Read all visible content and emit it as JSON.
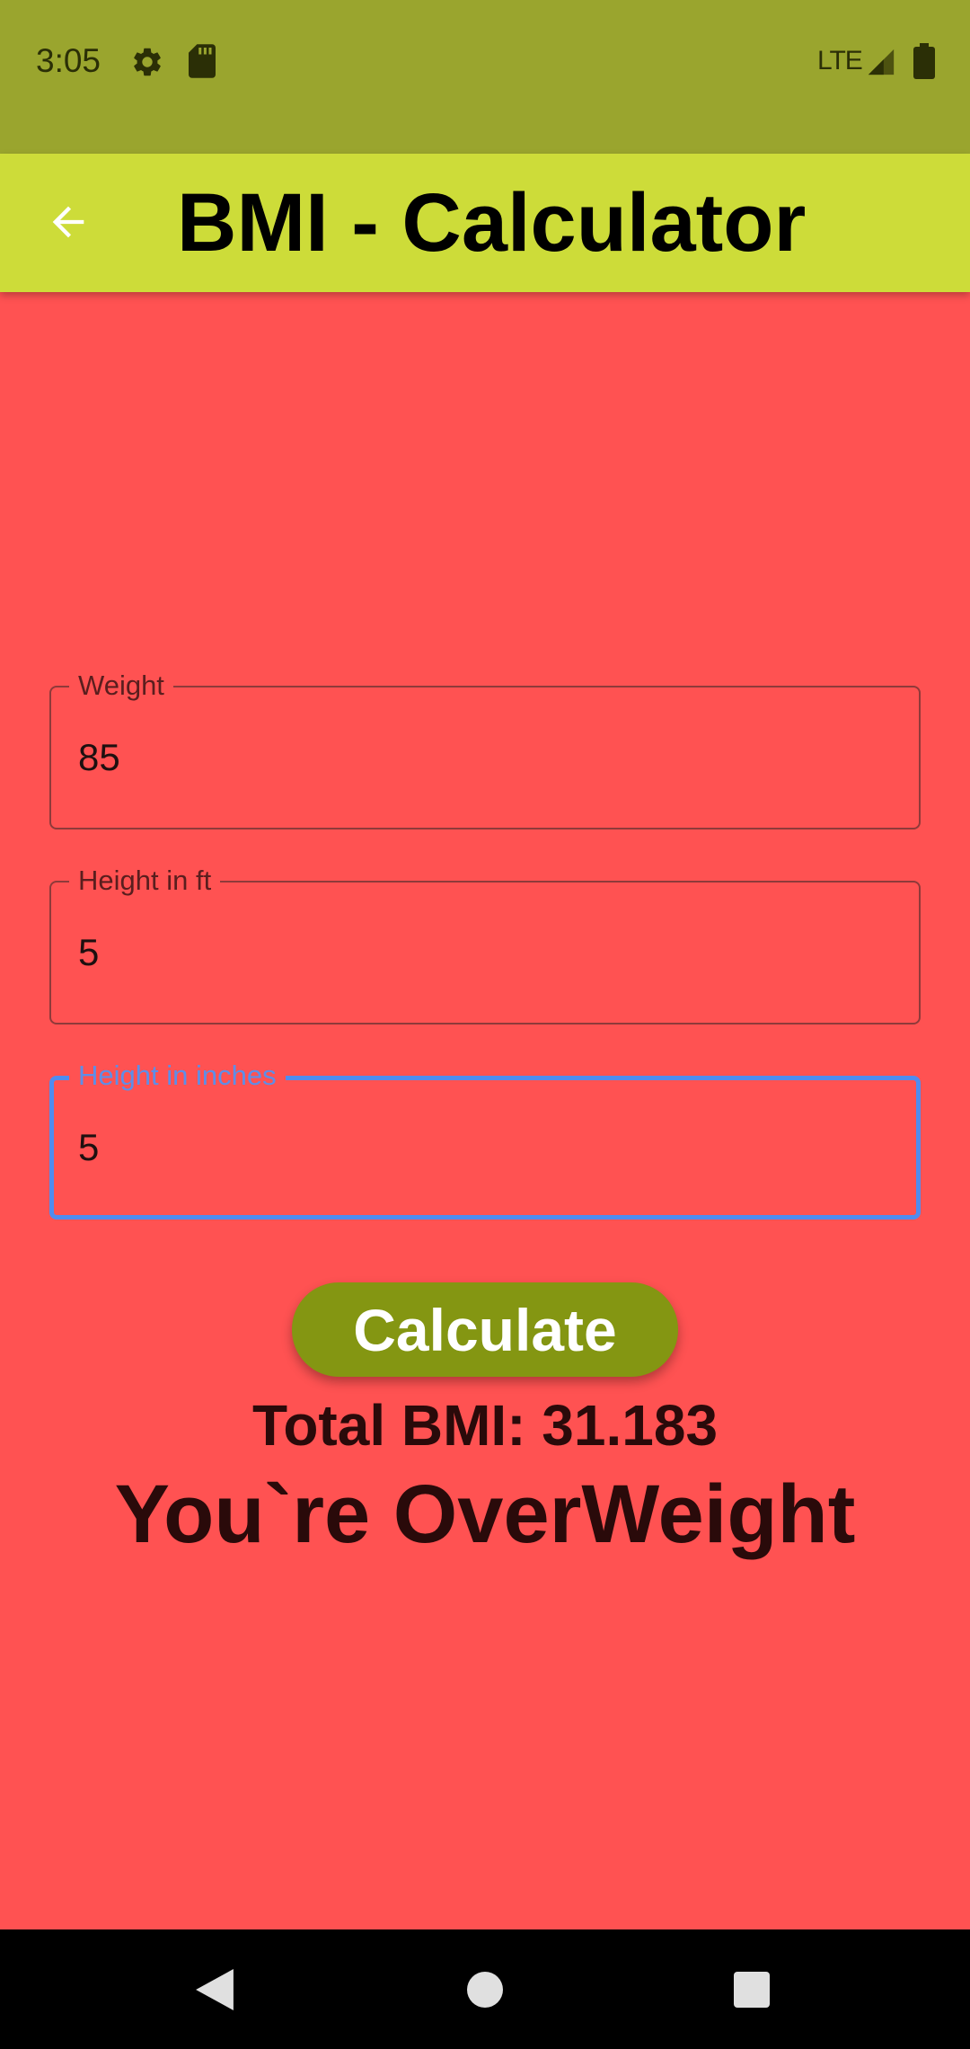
{
  "status_bar": {
    "time": "3:05",
    "network": "LTE",
    "icons": [
      "settings-gear-icon",
      "sd-card-icon",
      "signal-icon",
      "battery-icon"
    ]
  },
  "app_bar": {
    "title": "BMI - Calculator",
    "back_icon": "arrow-back-icon"
  },
  "form": {
    "weight": {
      "label": "Weight",
      "value": "85"
    },
    "height_ft": {
      "label": "Height in ft",
      "value": "5"
    },
    "height_in": {
      "label": "Height in inches",
      "value": "5",
      "focused": true
    }
  },
  "calculate_label": "Calculate",
  "result": {
    "bmi_text": "Total BMI: 31.183",
    "status_text": "You`re OverWeight"
  },
  "colors": {
    "background": "#ff5252",
    "status_bar": "#9aa52e",
    "app_bar": "#cddc39",
    "button": "#849612",
    "focus": "#4f8cf0"
  },
  "nav_bar": {
    "icons": [
      "nav-back-icon",
      "nav-home-icon",
      "nav-recents-icon"
    ]
  }
}
